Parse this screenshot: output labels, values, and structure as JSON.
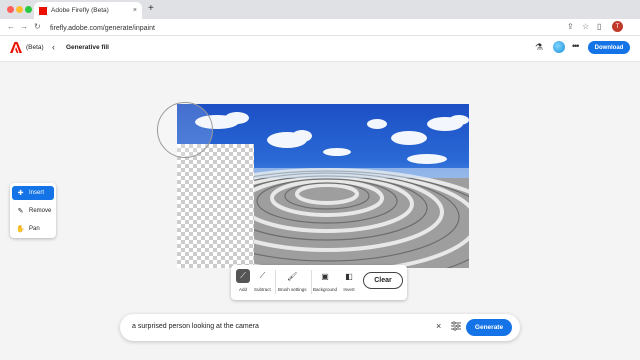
{
  "browser": {
    "tab_title": "Adobe Firefly (Beta)",
    "url": "firefly.adobe.com/generate/inpaint",
    "profile_initial": "T",
    "tab_close_glyph": "×",
    "new_tab_glyph": "+"
  },
  "header": {
    "beta_label": "(Beta)",
    "page_title": "Generative fill",
    "download_label": "Download",
    "more_glyph": "•••"
  },
  "tools": {
    "items": [
      {
        "label": "Insert",
        "icon": "insert-icon",
        "active": true
      },
      {
        "label": "Remove",
        "icon": "remove-icon",
        "active": false
      },
      {
        "label": "Pan",
        "icon": "hand-icon",
        "active": false
      }
    ]
  },
  "toolbar": {
    "add_label": "Add",
    "subtract_label": "Subtract",
    "brush_settings_label": "Brush settings",
    "background_label": "Background",
    "invert_label": "Invert",
    "clear_label": "Clear"
  },
  "prompt": {
    "value": "a surprised person looking at the camera",
    "clear_glyph": "×",
    "generate_label": "Generate"
  },
  "colors": {
    "accent": "#1473e6",
    "brand": "#eb1000"
  }
}
